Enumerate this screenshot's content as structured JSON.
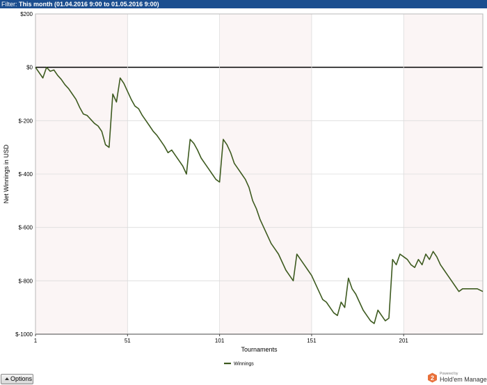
{
  "filter": {
    "label": "Filter:",
    "value": "This month (01.04.2016 9:00 to 01.05.2016 9:00)"
  },
  "colors": {
    "line": "#3d5a1f",
    "band": "#fbf5f5",
    "grid": "#dcdcdc",
    "zero_line": "#000000",
    "header_bar": "#1b4e8f",
    "brand_accent": "#e8703a"
  },
  "chart_data": {
    "type": "line",
    "xlabel": "Tournaments",
    "ylabel": "Net Winnings in USD",
    "x_ticks": [
      1,
      51,
      101,
      151,
      201
    ],
    "x_tick_labels": [
      "1",
      "51",
      "101",
      "151",
      "201"
    ],
    "y_ticks": [
      200,
      0,
      -200,
      -400,
      -600,
      -800,
      -1000
    ],
    "y_tick_labels": [
      "$200",
      "$0",
      "$-200",
      "$-400",
      "$-600",
      "$-800",
      "$-1000"
    ],
    "xlim": [
      1,
      244
    ],
    "ylim": [
      -1000,
      200
    ],
    "alternating_bands": true,
    "grid": true,
    "legend_position": "bottom-center",
    "series": [
      {
        "name": "Winnings",
        "x": [
          1,
          5,
          7,
          9,
          11,
          13,
          15,
          17,
          19,
          21,
          23,
          25,
          27,
          29,
          31,
          33,
          35,
          37,
          39,
          41,
          43,
          45,
          47,
          49,
          51,
          53,
          55,
          57,
          59,
          61,
          63,
          65,
          67,
          69,
          71,
          73,
          75,
          77,
          79,
          81,
          83,
          85,
          87,
          89,
          91,
          93,
          95,
          97,
          99,
          101,
          103,
          105,
          107,
          109,
          111,
          113,
          115,
          117,
          119,
          121,
          123,
          125,
          127,
          129,
          131,
          133,
          135,
          137,
          139,
          141,
          143,
          145,
          147,
          149,
          151,
          153,
          155,
          157,
          159,
          161,
          163,
          165,
          167,
          169,
          171,
          173,
          175,
          177,
          179,
          181,
          183,
          185,
          187,
          189,
          191,
          193,
          195,
          197,
          199,
          201,
          203,
          205,
          207,
          209,
          211,
          213,
          215,
          217,
          219,
          221,
          223,
          225,
          227,
          229,
          231,
          233,
          235,
          237,
          239,
          241,
          244
        ],
        "y": [
          0,
          -40,
          0,
          -15,
          -10,
          -30,
          -45,
          -65,
          -80,
          -100,
          -120,
          -150,
          -175,
          -180,
          -195,
          -210,
          -220,
          -240,
          -290,
          -300,
          -100,
          -130,
          -40,
          -60,
          -90,
          -120,
          -145,
          -155,
          -180,
          -200,
          -220,
          -240,
          -255,
          -275,
          -295,
          -320,
          -310,
          -330,
          -350,
          -370,
          -400,
          -270,
          -285,
          -310,
          -340,
          -360,
          -380,
          -400,
          -420,
          -430,
          -270,
          -290,
          -320,
          -360,
          -380,
          -400,
          -420,
          -450,
          -500,
          -530,
          -570,
          -600,
          -630,
          -660,
          -680,
          -700,
          -730,
          -760,
          -780,
          -800,
          -700,
          -720,
          -740,
          -760,
          -780,
          -810,
          -840,
          -870,
          -880,
          -900,
          -920,
          -930,
          -880,
          -900,
          -790,
          -830,
          -850,
          -880,
          -910,
          -930,
          -950,
          -960,
          -910,
          -930,
          -950,
          -940,
          -720,
          -740,
          -700,
          -710,
          -720,
          -740,
          -750,
          -720,
          -740,
          -700,
          -720,
          -690,
          -710,
          -740,
          -760,
          -780,
          -800,
          -820,
          -840,
          -830,
          -830,
          -830,
          -830,
          -830,
          -840
        ]
      }
    ]
  },
  "options_button": {
    "label": "Options"
  },
  "brand": {
    "powered_by": "Powered by",
    "name": "Hold'em Manager",
    "badge": "2"
  }
}
